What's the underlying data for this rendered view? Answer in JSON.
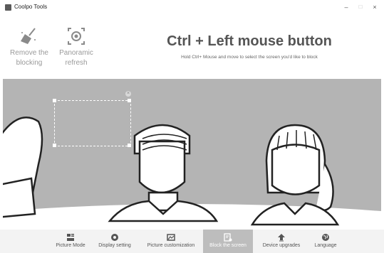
{
  "window": {
    "title": "Coolpo Tools",
    "minimize": "–",
    "maximize": "□",
    "close": "×"
  },
  "tools": [
    {
      "label": "Remove the\nblocking",
      "icon": "broom-icon"
    },
    {
      "label": "Panoramic\nrefresh",
      "icon": "panorama-refresh-icon"
    }
  ],
  "hint": {
    "title": "Ctrl + Left mouse button",
    "subtitle": "Hold Ctrl+ Mouse and move to select the screen you'd like to block"
  },
  "selection": {
    "close": "×"
  },
  "nav": [
    {
      "label": "Picture Mode",
      "icon": "picture-mode-icon",
      "active": false
    },
    {
      "label": "Display setting",
      "icon": "display-setting-icon",
      "active": false
    },
    {
      "label": "Picture customization",
      "icon": "picture-customization-icon",
      "active": false
    },
    {
      "label": "Block the screen",
      "icon": "block-screen-icon",
      "active": true
    },
    {
      "label": "Device upgrades",
      "icon": "device-upgrade-icon",
      "active": false
    },
    {
      "label": "Language",
      "icon": "language-icon",
      "active": false
    }
  ],
  "colors": {
    "preview_bg": "#b4b4b4",
    "active_tab": "#bdbdbd"
  }
}
